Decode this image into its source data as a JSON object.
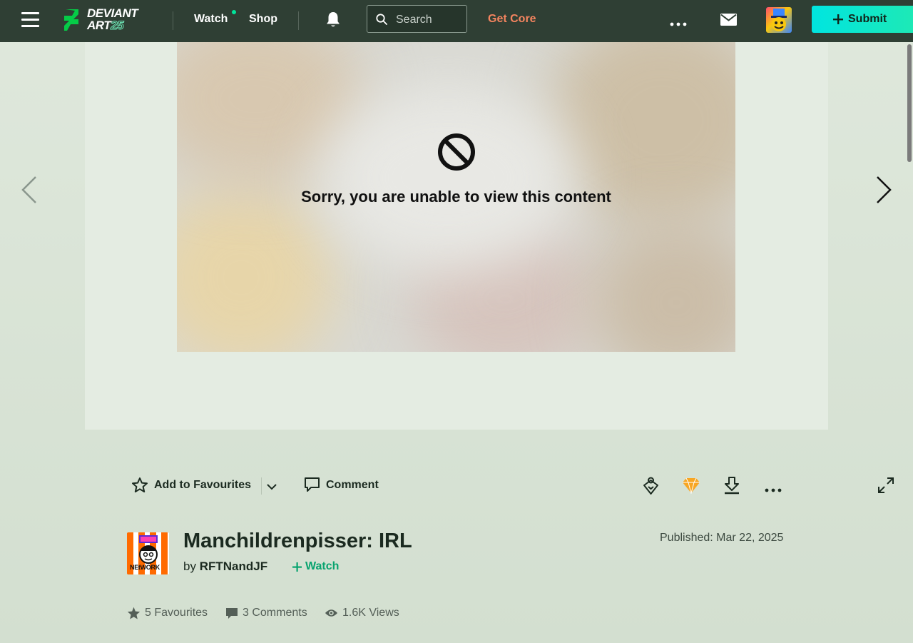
{
  "header": {
    "logo_line1": "DEVIANT",
    "logo_line2": "ART",
    "logo_badge": "25",
    "watch_label": "Watch",
    "shop_label": "Shop",
    "search_placeholder": "Search",
    "get_core_label": "Get Core",
    "submit_label": "Submit",
    "accent_color": "#00e59b"
  },
  "viewer": {
    "blocked_message": "Sorry, you are unable to view this content"
  },
  "actions": {
    "favourite_label": "Add to Favourites",
    "comment_label": "Comment"
  },
  "deviation": {
    "title": "Manchildrenpisser: IRL",
    "by_prefix": "by",
    "author": "RFTNandJF",
    "watch_label": "Watch",
    "published": "Published: Mar 22, 2025",
    "avatar_text": "NEtWORK"
  },
  "stats": {
    "favourites": "5 Favourites",
    "comments": "3 Comments",
    "views": "1.6K Views"
  }
}
